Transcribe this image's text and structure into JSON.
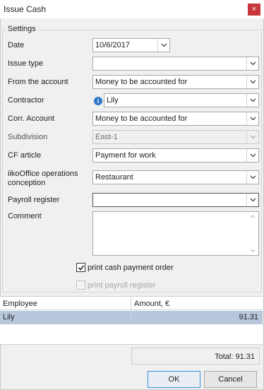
{
  "window": {
    "title": "Issue Cash",
    "close_glyph": "×"
  },
  "settings": {
    "legend": "Settings",
    "date": {
      "label": "Date",
      "value": "10/6/2017"
    },
    "issue_type": {
      "label": "Issue type",
      "value": ""
    },
    "from_account": {
      "label": "From the account",
      "value": "Money to be accounted for"
    },
    "contractor": {
      "label": "Contractor",
      "value": "Lily",
      "info_glyph": "i"
    },
    "corr_account": {
      "label": "Corr. Account",
      "value": "Money to be accounted for"
    },
    "subdivision": {
      "label": "Subdivision",
      "value": "East-1"
    },
    "cf_article": {
      "label": "CF article",
      "value": "Payment for work"
    },
    "operations_conception": {
      "label": "iikoOffice operations conception",
      "label_line1": "iikoOffice operations",
      "label_line2": "conception",
      "value": "Restaurant"
    },
    "payroll_register": {
      "label": "Payroll register",
      "value": ""
    },
    "comment": {
      "label": "Comment",
      "value": ""
    },
    "print_cash_order": {
      "label": "print cash payment order",
      "checked": true
    },
    "print_payroll": {
      "label": "print payroll register",
      "checked": false,
      "enabled": false
    }
  },
  "grid": {
    "columns": [
      "Employee",
      "Amount, €"
    ],
    "rows": [
      {
        "employee": "Lily",
        "amount": "91.31"
      }
    ]
  },
  "total": {
    "text": "Total: 91.31"
  },
  "buttons": {
    "ok": "OK",
    "cancel": "Cancel"
  },
  "colors": {
    "selection": "#b8c7dc",
    "close": "#c8373b",
    "info": "#2f78c9",
    "primary_border": "#3a8fd6"
  }
}
